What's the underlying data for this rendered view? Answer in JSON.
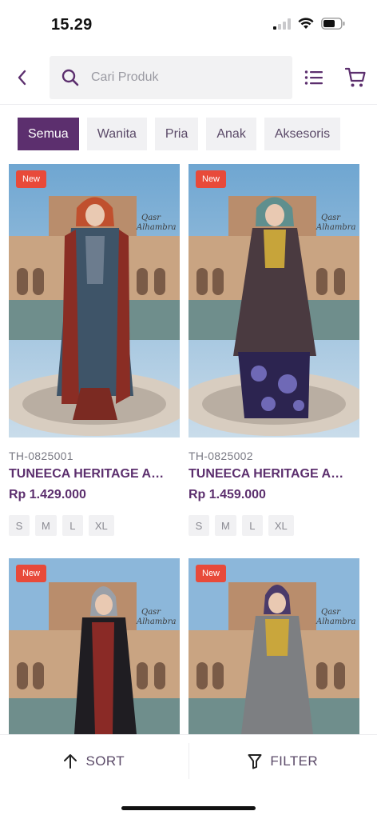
{
  "status": {
    "time": "15.29"
  },
  "search": {
    "placeholder": "Cari Produk"
  },
  "tabs": [
    {
      "label": "Semua",
      "active": true
    },
    {
      "label": "Wanita",
      "active": false
    },
    {
      "label": "Pria",
      "active": false
    },
    {
      "label": "Anak",
      "active": false
    },
    {
      "label": "Aksesoris",
      "active": false
    }
  ],
  "products": [
    {
      "badge": "New",
      "sku": "TH-0825001",
      "name": "TUNEECA HERITAGE Aba...",
      "price": "Rp 1.429.000",
      "sizes": [
        "S",
        "M",
        "L",
        "XL"
      ]
    },
    {
      "badge": "New",
      "sku": "TH-0825002",
      "name": "TUNEECA HERITAGE Aba...",
      "price": "Rp 1.459.000",
      "sizes": [
        "S",
        "M",
        "L",
        "XL"
      ]
    },
    {
      "badge": "New"
    },
    {
      "badge": "New"
    }
  ],
  "bottom": {
    "sort_label": "SORT",
    "filter_label": "FILTER"
  },
  "colors": {
    "brand": "#5c2f6e",
    "badge": "#e84a3a"
  }
}
